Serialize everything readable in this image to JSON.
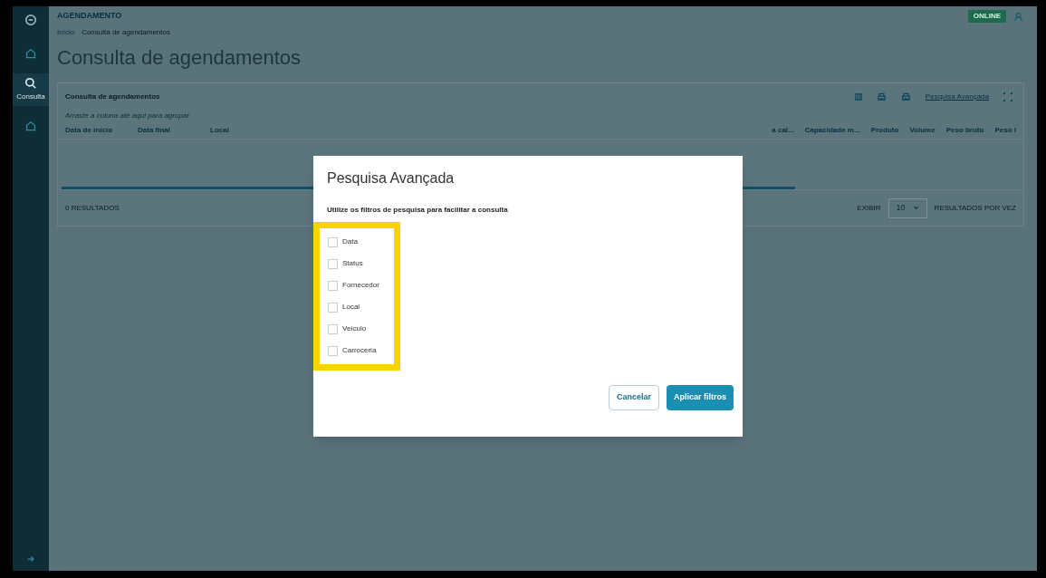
{
  "sidebar": {
    "items": [
      {
        "kind": "home",
        "selected": false
      },
      {
        "kind": "search",
        "label": "Consulta",
        "selected": true
      },
      {
        "kind": "home",
        "selected": false
      }
    ]
  },
  "header": {
    "app_title": "AGENDAMENTO",
    "status_badge": "ONLINE"
  },
  "breadcrumb": [
    "Início",
    "Consulta de agendamentos"
  ],
  "page_title": "Consulta de agendamentos",
  "card": {
    "title": "Consulta de agendamentos",
    "advanced_search_link": "Pesquisa Avançada",
    "group_hint": "Arraste a coluna até aqui para agrupar",
    "columns_left": [
      "Data de início",
      "Data final",
      "Local"
    ],
    "columns_right": [
      "a cal...",
      "Capacidade m...",
      "Produto",
      "Volume",
      "Peso bruto",
      "Peso l"
    ],
    "results": "0 RESULTADOS",
    "show_label": "EXIBIR",
    "page_size": "10",
    "per_page_label": "RESULTADOS POR VEZ"
  },
  "dialog": {
    "title": "Pesquisa Avançada",
    "subtitle": "Utilize os filtros de pesquisa para facilitar a consulta",
    "filters": [
      {
        "label": "Data",
        "checked": false
      },
      {
        "label": "Status",
        "checked": false
      },
      {
        "label": "Fornecedor",
        "checked": false
      },
      {
        "label": "Local",
        "checked": false
      },
      {
        "label": "Veículo",
        "checked": false
      },
      {
        "label": "Carroceria",
        "checked": false
      }
    ],
    "highlighted": true,
    "cancel": "Cancelar",
    "apply": "Aplicar filtros"
  }
}
